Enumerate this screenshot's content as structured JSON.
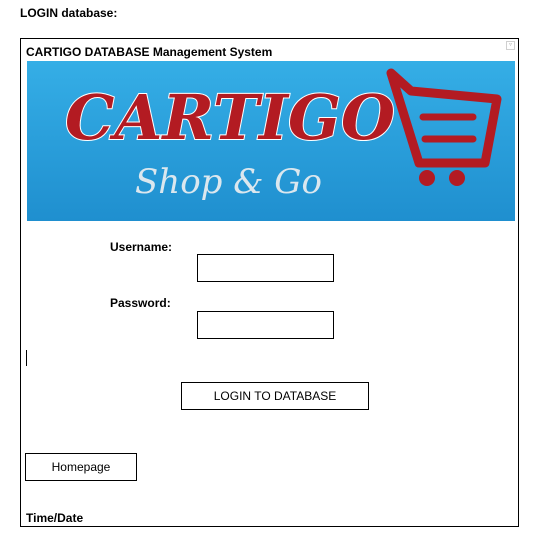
{
  "page": {
    "title": "LOGIN database:"
  },
  "panel": {
    "title": "CARTIGO DATABASE Management System",
    "corner_icon": "expand-arrow-icon",
    "corner_glyph": "▿"
  },
  "banner": {
    "brand": "CARTIGO",
    "tagline": "Shop & Go",
    "background_color": "#2aa0dc",
    "brand_color": "#b31b22",
    "tagline_color": "#dbe7ee",
    "icon": "shopping-cart-icon"
  },
  "login": {
    "username_label": "Username:",
    "username_value": "",
    "password_label": "Password:",
    "password_value": "",
    "submit_label": "LOGIN TO DATABASE"
  },
  "nav": {
    "homepage_label": "Homepage"
  },
  "footer": {
    "time_label": "Time/Date"
  }
}
